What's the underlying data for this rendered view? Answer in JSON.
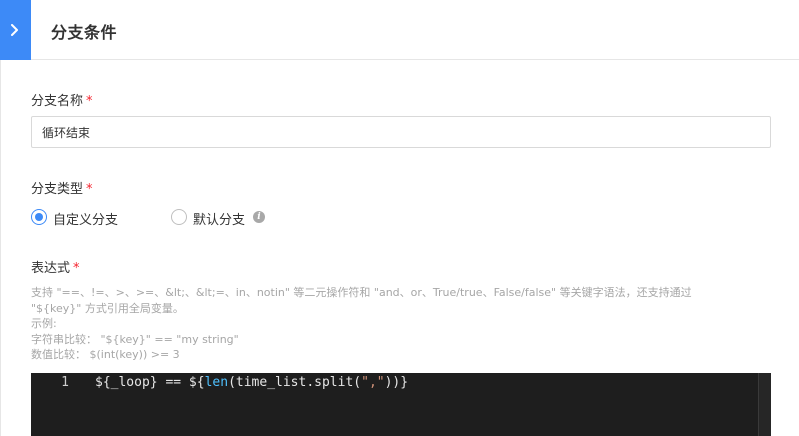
{
  "header": {
    "title": "分支条件"
  },
  "branch_name": {
    "label": "分支名称",
    "required_mark": "*",
    "value": "循环结束"
  },
  "branch_type": {
    "label": "分支类型",
    "required_mark": "*",
    "options": [
      {
        "label": "自定义分支",
        "selected": true
      },
      {
        "label": "默认分支",
        "selected": false
      }
    ],
    "info_glyph": "i"
  },
  "expression": {
    "label": "表达式",
    "required_mark": "*",
    "hint_lines": [
      "支持 \"==、!=、>、>=、&lt;、&lt;=、in、notin\" 等二元操作符和 \"and、or、True/true、False/false\" 等关键字语法，还支持通过",
      "\"${key}\" 方式引用全局变量。",
      "示例:",
      "字符串比较： \"${key}\" == \"my string\"",
      "数值比较： $(int(key)) >= 3"
    ],
    "editor": {
      "line_number": "1",
      "code_parts": {
        "p1": "${_loop} == ${",
        "fn": "len",
        "p2": "(time_list.split(",
        "str": "\",\"",
        "p3": "))}"
      }
    }
  },
  "colors": {
    "accent": "#3d8af7",
    "required": "#f5222d",
    "hint": "#a6a6a6",
    "editor_bg": "#1e1e1e"
  },
  "icons": {
    "collapse": "chevron-right-icon",
    "info": "info-icon"
  }
}
